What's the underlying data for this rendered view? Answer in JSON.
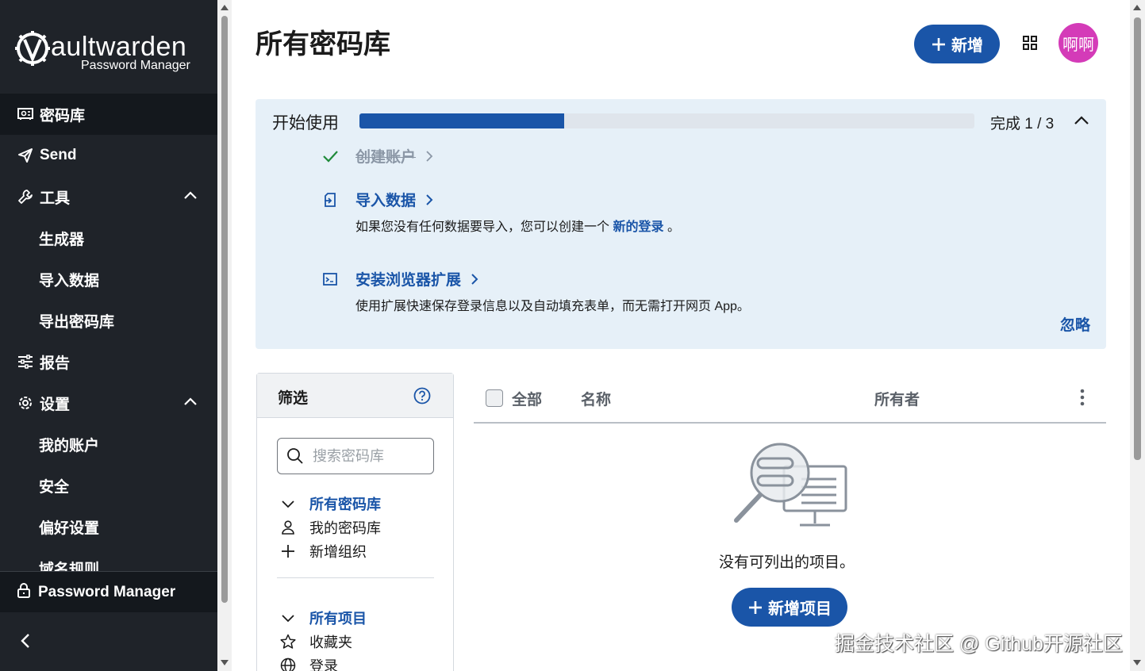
{
  "sidebar": {
    "logo_text": "aultwarden",
    "logo_sub": "Password Manager",
    "items": [
      {
        "label": "密码库"
      },
      {
        "label": "Send"
      },
      {
        "label": "工具"
      },
      {
        "label": "报告"
      },
      {
        "label": "设置"
      }
    ],
    "tools_sub": [
      "生成器",
      "导入数据",
      "导出密码库"
    ],
    "settings_sub": [
      "我的账户",
      "安全",
      "偏好设置",
      "域名规则"
    ],
    "product_switcher": "Password Manager"
  },
  "header": {
    "title": "所有密码库",
    "new_button": "新增",
    "avatar_text": "啊啊"
  },
  "onboarding": {
    "title": "开始使用",
    "progress_fraction": 0.333,
    "status": "完成 1 / 3",
    "tasks": [
      {
        "label": "创建账户",
        "done": true
      },
      {
        "label": "导入数据",
        "done": false,
        "desc_prefix": "如果您没有任何数据要导入，您可以创建一个",
        "desc_link": "新的登录",
        "desc_suffix": "。"
      },
      {
        "label": "安装浏览器扩展",
        "done": false,
        "desc": "使用扩展快速保存登录信息以及自动填充表单，而无需打开网页 App。"
      }
    ],
    "dismiss": "忽略"
  },
  "filter": {
    "title": "筛选",
    "search_placeholder": "搜索密码库",
    "vaults": [
      {
        "label": "所有密码库",
        "selected": true
      },
      {
        "label": "我的密码库"
      },
      {
        "label": "新增组织"
      }
    ],
    "types": [
      {
        "label": "所有项目",
        "selected": true
      },
      {
        "label": "收藏夹"
      },
      {
        "label": "登录"
      }
    ]
  },
  "table": {
    "col_all": "全部",
    "col_name": "名称",
    "col_owner": "所有者",
    "empty_text": "没有可列出的项目。",
    "add_item_button": "新增项目"
  },
  "watermark": "掘金技术社区 @ Github开源社区",
  "colors": {
    "accent": "#1a55a8",
    "sidebar_bg": "#1f2329",
    "onboard_bg": "#e6f0f8",
    "avatar": "#d43bb8"
  }
}
